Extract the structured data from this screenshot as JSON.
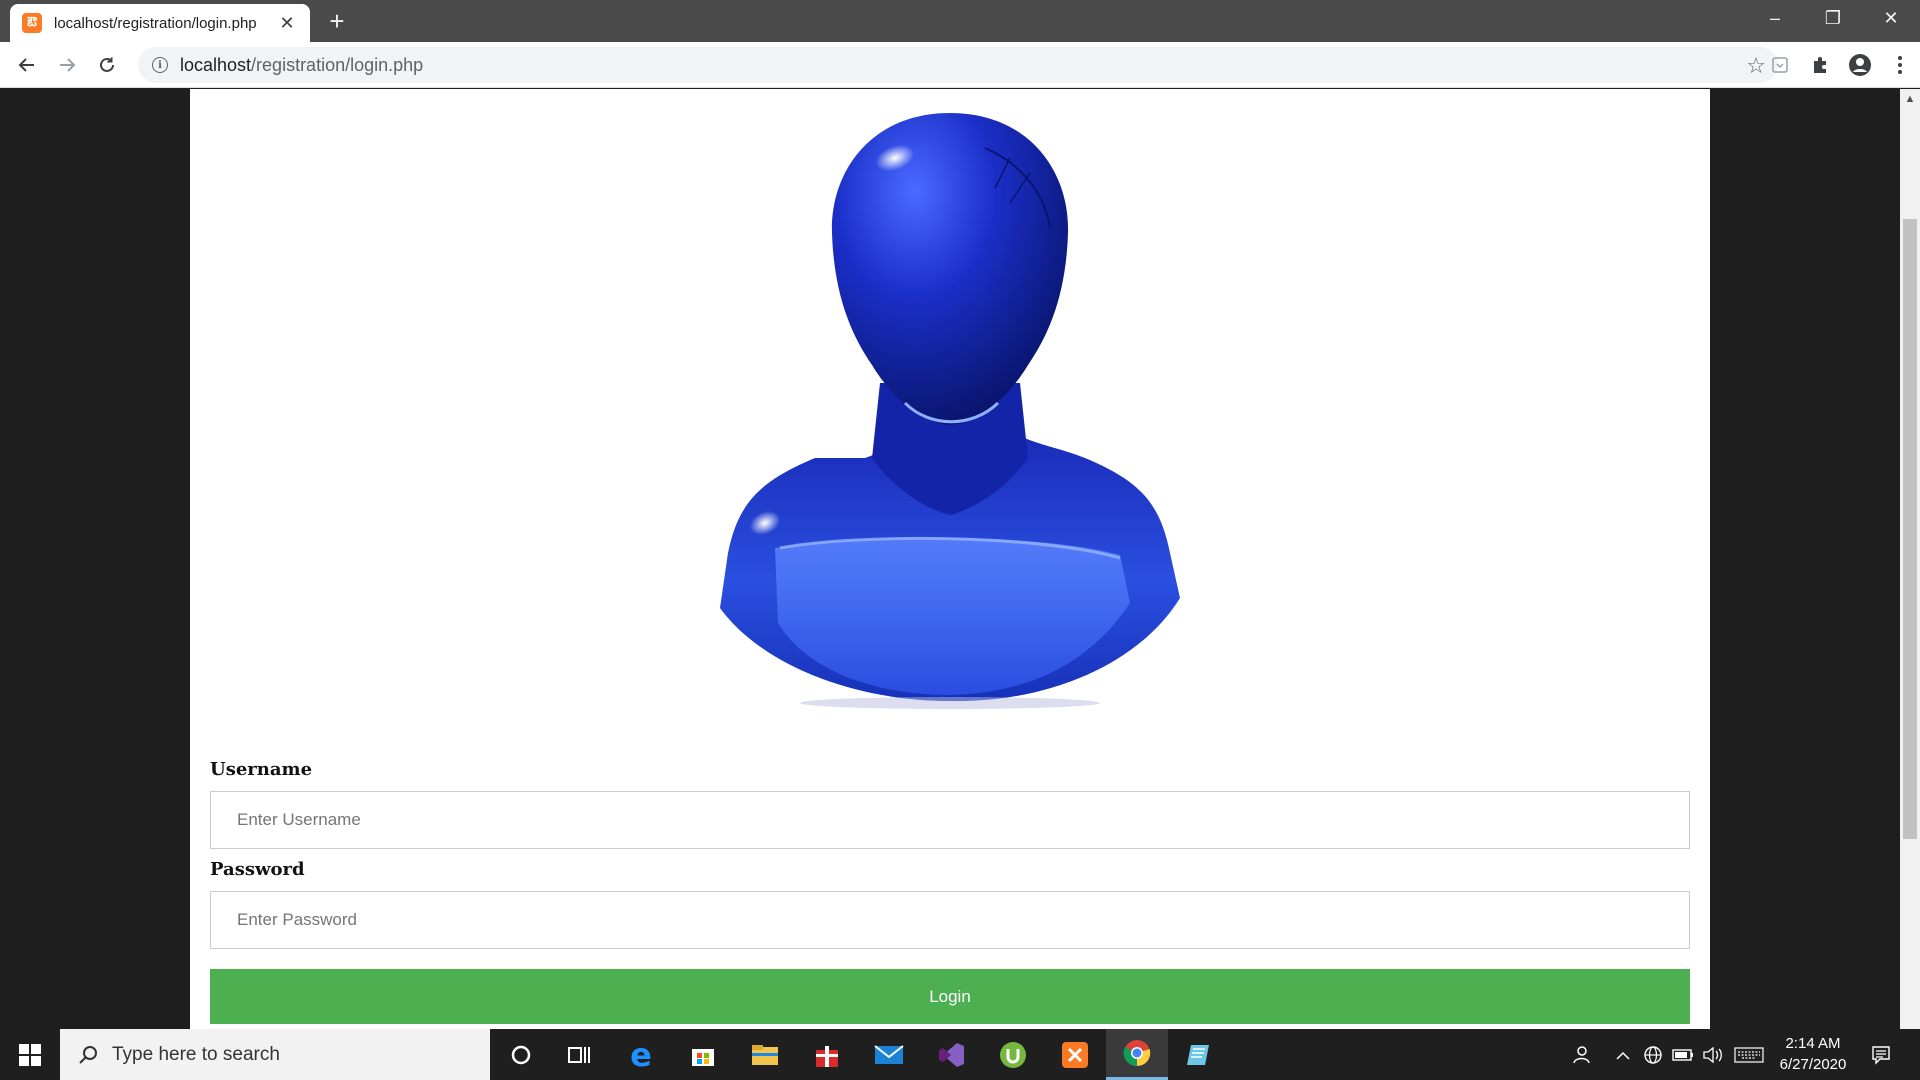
{
  "browser": {
    "tab_title": "localhost/registration/login.php",
    "tab_favicon": "xampp-icon",
    "url_host": "localhost",
    "url_path": "/registration/login.php"
  },
  "form": {
    "username_label": "Username",
    "username_placeholder": "Enter Username",
    "password_label": "Password",
    "password_placeholder": "Enter Password",
    "login_label": "Login",
    "login_color": "#4caf50"
  },
  "avatar": {
    "icon": "user-avatar-icon",
    "color": "#1f3fd6"
  },
  "taskbar": {
    "search_placeholder": "Type here to search",
    "time": "2:14 AM",
    "date": "6/27/2020",
    "apps": [
      "cortana-icon",
      "task-view-icon",
      "edge-icon",
      "store-icon",
      "file-explorer-icon",
      "gift-icon",
      "mail-icon",
      "visual-studio-icon",
      "utorrent-icon",
      "xampp-icon",
      "chrome-icon",
      "notepad-icon"
    ]
  }
}
